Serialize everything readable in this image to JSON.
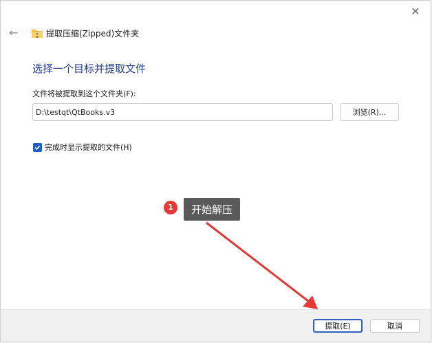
{
  "dialog": {
    "title": "提取压缩(Zipped)文件夹",
    "heading": "选择一个目标并提取文件",
    "field_label": "文件将被提取到这个文件夹(F):",
    "path_value": "D:\\testqt\\QtBooks.v3",
    "browse_label": "浏览(R)...",
    "checkbox_label": "完成时显示提取的文件(H)",
    "checkbox_checked": true,
    "extract_label": "提取(E)",
    "cancel_label": "取消"
  },
  "annotation": {
    "step_number": "1",
    "text": "开始解压",
    "arrow_color": "#e53935"
  },
  "icons": {
    "close": "close-icon",
    "back": "back-arrow-icon",
    "folder": "zip-folder-icon",
    "check": "checkmark-icon"
  },
  "colors": {
    "heading": "#1f3b8a",
    "accent": "#1f5fbf",
    "badge": "#e53935",
    "callout_bg": "#5a5a5a"
  }
}
